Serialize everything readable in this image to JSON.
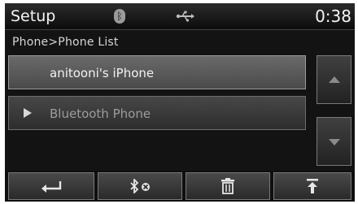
{
  "header": {
    "title": "Setup",
    "clock": "0:38",
    "bluetooth_icon_glyph": "ᛒ",
    "icons": [
      "bluetooth-icon",
      "usb-icon"
    ]
  },
  "breadcrumb": "Phone>Phone List",
  "phone_list": {
    "items": [
      {
        "label": "anitooni's iPhone",
        "state": "selected"
      },
      {
        "label": "Bluetooth Phone",
        "state": "disabled",
        "icon": "play-icon"
      }
    ]
  },
  "scroll": {
    "up_icon": "scroll-up-icon",
    "down_icon": "scroll-down-icon"
  },
  "toolbar": {
    "buttons": [
      {
        "name": "back-button",
        "icon": "back-arrow-icon"
      },
      {
        "name": "disconnect-bluetooth-button",
        "icon": "bluetooth-disconnect-icon"
      },
      {
        "name": "delete-button",
        "icon": "trash-icon"
      },
      {
        "name": "set-priority-button",
        "icon": "move-top-icon"
      }
    ]
  },
  "colors": {
    "background": "#131313",
    "text": "#f2f2f2",
    "disabled_text": "#9c9c9c",
    "border": "#7a7a7a"
  }
}
